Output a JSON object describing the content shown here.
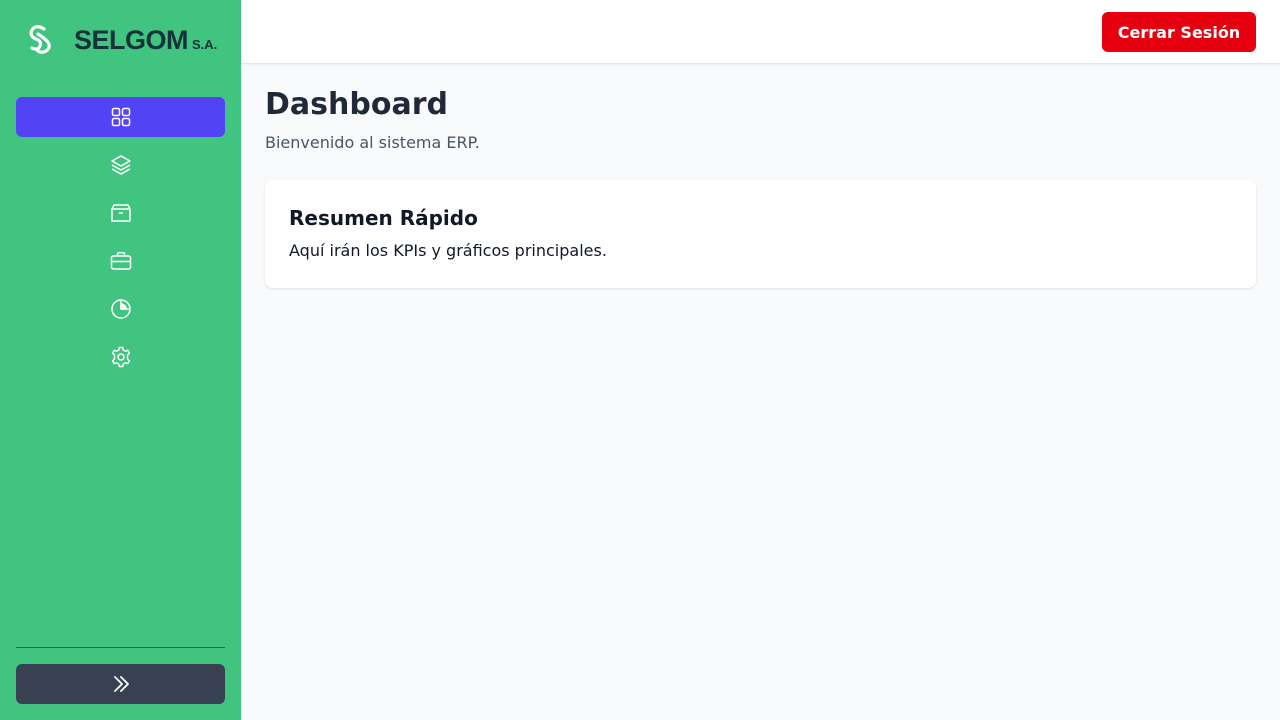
{
  "brand": {
    "name": "SELGOM",
    "suffix": "S.A."
  },
  "sidebar": {
    "items": [
      {
        "icon": "dashboard-grid-icon",
        "active": true
      },
      {
        "icon": "layers-icon",
        "active": false
      },
      {
        "icon": "archive-box-icon",
        "active": false
      },
      {
        "icon": "briefcase-icon",
        "active": false
      },
      {
        "icon": "pie-chart-icon",
        "active": false
      },
      {
        "icon": "gear-icon",
        "active": false
      }
    ],
    "collapse_icon": "chevron-double-right-icon"
  },
  "header": {
    "logout_label": "Cerrar Sesión"
  },
  "main": {
    "title": "Dashboard",
    "subtitle": "Bienvenido al sistema ERP.",
    "card": {
      "title": "Resumen Rápido",
      "text": "Aquí irán los KPIs y gráficos principales."
    }
  },
  "colors": {
    "sidebar_bg": "#41c47f",
    "active_item": "#5243f5",
    "logout_button": "#e6000f",
    "collapse_button": "#374151",
    "page_bg": "#f8fafc"
  }
}
